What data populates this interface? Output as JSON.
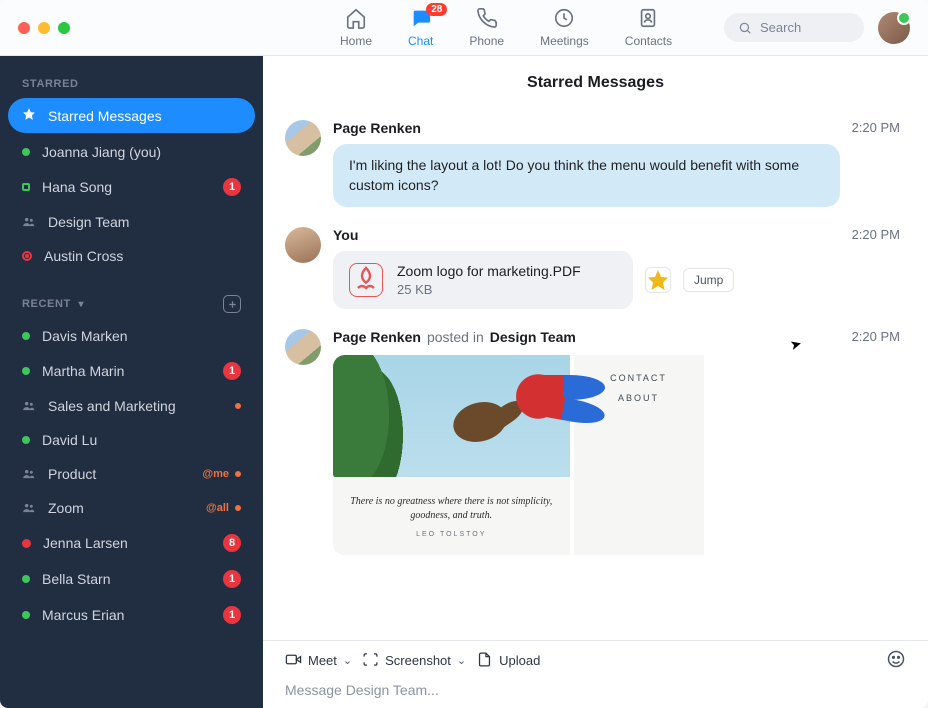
{
  "topnav": {
    "items": [
      {
        "label": "Home"
      },
      {
        "label": "Chat",
        "badge": "28",
        "active": true
      },
      {
        "label": "Phone"
      },
      {
        "label": "Meetings"
      },
      {
        "label": "Contacts"
      }
    ],
    "search_placeholder": "Search"
  },
  "sidebar": {
    "section_starred": "STARRED",
    "section_recent": "RECENT",
    "starred_items": [
      {
        "label": "Starred Messages",
        "kind": "star",
        "active": true
      },
      {
        "label": "Joanna Jiang (you)",
        "kind": "online"
      },
      {
        "label": "Hana Song",
        "kind": "away",
        "badge": "1"
      },
      {
        "label": "Design Team",
        "kind": "group"
      },
      {
        "label": "Austin Cross",
        "kind": "record"
      }
    ],
    "recent_items": [
      {
        "label": "Davis Marken",
        "kind": "online"
      },
      {
        "label": "Martha Marin",
        "kind": "online",
        "badge": "1"
      },
      {
        "label": "Sales and Marketing",
        "kind": "group",
        "dot": true
      },
      {
        "label": "David Lu",
        "kind": "online"
      },
      {
        "label": "Product",
        "kind": "group",
        "mention": "@me",
        "dot": true
      },
      {
        "label": "Zoom",
        "kind": "group",
        "mention": "@all",
        "dot": true
      },
      {
        "label": "Jenna Larsen",
        "kind": "busy",
        "badge": "8"
      },
      {
        "label": "Bella Starn",
        "kind": "online",
        "badge": "1"
      },
      {
        "label": "Marcus Erian",
        "kind": "online",
        "badge": "1"
      }
    ]
  },
  "main": {
    "title": "Starred Messages",
    "messages": [
      {
        "author": "Page Renken",
        "time": "2:20 PM",
        "avatar": "av-page",
        "bubble": "I'm liking the layout a lot! Do you think the menu would benefit with some custom icons?"
      },
      {
        "author": "You",
        "time": "2:20 PM",
        "avatar": "av-you",
        "file": {
          "name": "Zoom logo for marketing.PDF",
          "size": "25 KB"
        },
        "jump_label": "Jump"
      },
      {
        "author": "Page Renken",
        "sub": "posted in",
        "channel": "Design Team",
        "time": "2:20 PM",
        "avatar": "av-page",
        "image": {
          "right_links": [
            "CONTACT",
            "ABOUT"
          ],
          "quote": "There is no greatness where there is not simplicity, goodness, and truth.",
          "quote_author": "LEO TOLSTOY"
        }
      }
    ]
  },
  "composer": {
    "actions": [
      {
        "label": "Meet",
        "icon": "video",
        "chevron": true
      },
      {
        "label": "Screenshot",
        "icon": "screenshot",
        "chevron": true
      },
      {
        "label": "Upload",
        "icon": "file"
      }
    ],
    "placeholder": "Message Design Team..."
  }
}
